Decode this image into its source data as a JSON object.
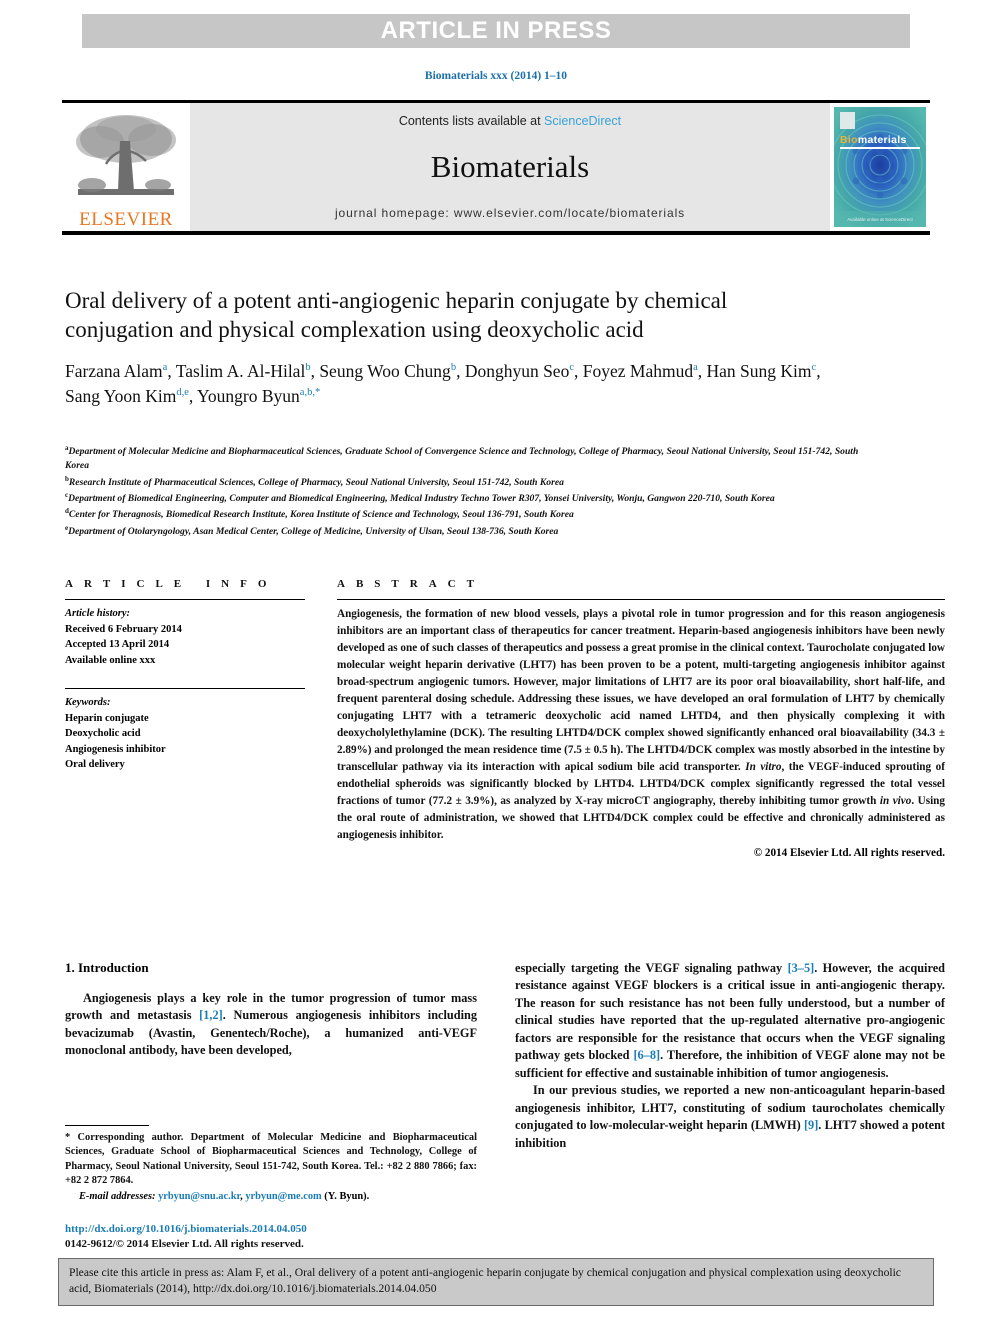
{
  "banner": {
    "text": "ARTICLE IN PRESS"
  },
  "journal_ref": "Biomaterials xxx (2014) 1–10",
  "masthead": {
    "contents_prefix": "Contents lists available at ",
    "contents_link": "ScienceDirect",
    "journal_title": "Biomaterials",
    "homepage": "journal homepage: www.elsevier.com/locate/biomaterials",
    "publisher": "ELSEVIER",
    "cover": {
      "title_b": "Bio",
      "title_rest": "materials",
      "footer": "Available online at\nScienceDirect"
    }
  },
  "article": {
    "title": "Oral delivery of a potent anti-angiogenic heparin conjugate by chemical conjugation and physical complexation using deoxycholic acid",
    "authors": [
      {
        "name": "Farzana Alam",
        "sup": "a",
        "sep": ", "
      },
      {
        "name": "Taslim A. Al-Hilal",
        "sup": "b",
        "sep": ", "
      },
      {
        "name": "Seung Woo Chung",
        "sup": "b",
        "sep": ", "
      },
      {
        "name": "Donghyun Seo",
        "sup": "c",
        "sep": ", "
      },
      {
        "name": "Foyez Mahmud",
        "sup": "a",
        "sep": ", "
      },
      {
        "name": "Han Sung Kim",
        "sup": "c",
        "sep": ", "
      },
      {
        "name": "Sang Yoon Kim",
        "sup": "d,e",
        "sep": ", "
      },
      {
        "name": "Youngro Byun",
        "sup": "a,b,*",
        "sep": ""
      }
    ],
    "affiliations": [
      {
        "mark": "a",
        "text": "Department of Molecular Medicine and Biopharmaceutical Sciences, Graduate School of Convergence Science and Technology, College of Pharmacy, Seoul National University, Seoul 151-742, South Korea"
      },
      {
        "mark": "b",
        "text": "Research Institute of Pharmaceutical Sciences, College of Pharmacy, Seoul National University, Seoul 151-742, South Korea"
      },
      {
        "mark": "c",
        "text": "Department of Biomedical Engineering, Computer and Biomedical Engineering, Medical Industry Techno Tower R307, Yonsei University, Wonju, Gangwon 220-710, South Korea"
      },
      {
        "mark": "d",
        "text": "Center for Theragnosis, Biomedical Research Institute, Korea Institute of Science and Technology, Seoul 136-791, South Korea"
      },
      {
        "mark": "e",
        "text": "Department of Otolaryngology, Asan Medical Center, College of Medicine, University of Ulsan, Seoul 138-736, South Korea"
      }
    ]
  },
  "article_info": {
    "heading": "ARTICLE INFO",
    "history_label": "Article history:",
    "history": [
      "Received 6 February 2014",
      "Accepted 13 April 2014",
      "Available online xxx"
    ],
    "keywords_label": "Keywords:",
    "keywords": [
      "Heparin conjugate",
      "Deoxycholic acid",
      "Angiogenesis inhibitor",
      "Oral delivery"
    ]
  },
  "abstract": {
    "heading": "ABSTRACT",
    "body_1": "Angiogenesis, the formation of new blood vessels, plays a pivotal role in tumor progression and for this reason angiogenesis inhibitors are an important class of therapeutics for cancer treatment. Heparin-based angiogenesis inhibitors have been newly developed as one of such classes of therapeutics and possess a great promise in the clinical context. Taurocholate conjugated low molecular weight heparin derivative (LHT7) has been proven to be a potent, multi-targeting angiogenesis inhibitor against broad-spectrum angiogenic tumors. However, major limitations of LHT7 are its poor oral bioavailability, short half-life, and frequent parenteral dosing schedule. Addressing these issues, we have developed an oral formulation of LHT7 by chemically conjugating LHT7 with a tetrameric deoxycholic acid named LHTD4, and then physically complexing it with deoxycholylethylamine (DCK). The resulting LHTD4/DCK complex showed significantly enhanced oral bioavailability (34.3 ± 2.89%) and prolonged the mean residence time (7.5 ± 0.5 h). The LHTD4/DCK complex was mostly absorbed in the intestine by transcellular pathway via its interaction with apical sodium bile acid transporter. ",
    "italic_1": "In vitro",
    "body_2": ", the VEGF-induced sprouting of endothelial spheroids was significantly blocked by LHTD4. LHTD4/DCK complex significantly regressed the total vessel fractions of tumor (77.2 ± 3.9%), as analyzed by X-ray microCT angiography, thereby inhibiting tumor growth ",
    "italic_2": "in vivo",
    "body_3": ". Using the oral route of administration, we showed that LHTD4/DCK complex could be effective and chronically administered as angiogenesis inhibitor.",
    "copyright": "© 2014 Elsevier Ltd. All rights reserved."
  },
  "introduction": {
    "heading": "1. Introduction",
    "left_para_1a": "Angiogenesis plays a key role in the tumor progression of tumor mass growth and metastasis ",
    "left_ref_1": "[1,2]",
    "left_para_1b": ". Numerous angiogenesis inhibitors including bevacizumab (Avastin, Genentech/Roche), a humanized anti-VEGF monoclonal antibody, have been developed,",
    "right_para_1a": "especially targeting the VEGF signaling pathway ",
    "right_ref_1": "[3–5]",
    "right_para_1b": ". However, the acquired resistance against VEGF blockers is a critical issue in anti-angiogenic therapy. The reason for such resistance has not been fully understood, but a number of clinical studies have reported that the up-regulated alternative pro-angiogenic factors are responsible for the resistance that occurs when the VEGF signaling pathway gets blocked ",
    "right_ref_2": "[6–8]",
    "right_para_1c": ". Therefore, the inhibition of VEGF alone may not be sufficient for effective and sustainable inhibition of tumor angiogenesis.",
    "right_para_2a": "In our previous studies, we reported a new non-anticoagulant heparin-based angiogenesis inhibitor, LHT7, constituting of sodium taurocholates chemically conjugated to low-molecular-weight heparin (LMWH) ",
    "right_ref_3": "[9]",
    "right_para_2b": ". LHT7 showed a potent inhibition"
  },
  "footnote": {
    "corresponding": "* Corresponding author. Department of Molecular Medicine and Biopharmaceutical Sciences, Graduate School of Biopharmaceutical Sciences and Technology, College of Pharmacy, Seoul National University, Seoul 151-742, South Korea. Tel.: +82 2 880 7866; fax: +82 2 872 7864.",
    "email_label": "E-mail addresses:",
    "email_1": "yrbyun@snu.ac.kr",
    "email_sep": ", ",
    "email_2": "yrbyun@me.com",
    "email_suffix": " (Y. Byun).",
    "doi": "http://dx.doi.org/10.1016/j.biomaterials.2014.04.050",
    "issn": "0142-9612/© 2014 Elsevier Ltd. All rights reserved."
  },
  "cite_box": {
    "text": "Please cite this article in press as: Alam F, et al., Oral delivery of a potent anti-angiogenic heparin conjugate by chemical conjugation and physical complexation using deoxycholic acid, Biomaterials (2014), http://dx.doi.org/10.1016/j.biomaterials.2014.04.050"
  }
}
